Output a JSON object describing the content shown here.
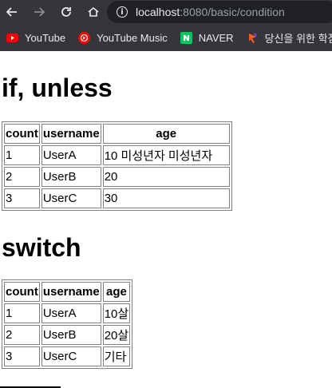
{
  "browser": {
    "url_host": "localhost",
    "url_path": ":8080/basic/condition",
    "bookmarks": [
      {
        "label": "YouTube",
        "icon": "youtube-icon"
      },
      {
        "label": "YouTube Music",
        "icon": "youtube-music-icon"
      },
      {
        "label": "NAVER",
        "icon": "naver-icon"
      },
      {
        "label": "당신을 위한 학점",
        "icon": "bookmark-icon"
      }
    ]
  },
  "section_if": {
    "heading": "if, unless",
    "headers": [
      "count",
      "username",
      "age"
    ],
    "rows": [
      [
        "1",
        "UserA",
        "10 미성년자 미성년자"
      ],
      [
        "2",
        "UserB",
        "20"
      ],
      [
        "3",
        "UserC",
        "30"
      ]
    ]
  },
  "section_switch": {
    "heading": "switch",
    "headers": [
      "count",
      "username",
      "age"
    ],
    "rows": [
      [
        "1",
        "UserA",
        "10살"
      ],
      [
        "2",
        "UserB",
        "20살"
      ],
      [
        "3",
        "UserC",
        "기타"
      ]
    ]
  }
}
